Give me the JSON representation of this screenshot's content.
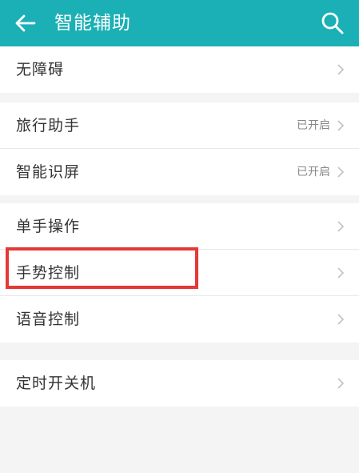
{
  "appbar": {
    "title": "智能辅助",
    "back_icon": "arrow-left-icon",
    "search_icon": "search-icon",
    "color": "#1ab0b5"
  },
  "groups": [
    {
      "items": [
        {
          "label": "无障碍",
          "status": ""
        }
      ]
    },
    {
      "items": [
        {
          "label": "旅行助手",
          "status": "已开启"
        },
        {
          "label": "智能识屏",
          "status": "已开启"
        }
      ]
    },
    {
      "items": [
        {
          "label": "单手操作",
          "status": ""
        },
        {
          "label": "手势控制",
          "status": ""
        },
        {
          "label": "语音控制",
          "status": ""
        }
      ]
    },
    {
      "items": [
        {
          "label": "定时开关机",
          "status": ""
        }
      ]
    }
  ],
  "highlight": {
    "color": "#e53935",
    "target": "手势控制"
  }
}
